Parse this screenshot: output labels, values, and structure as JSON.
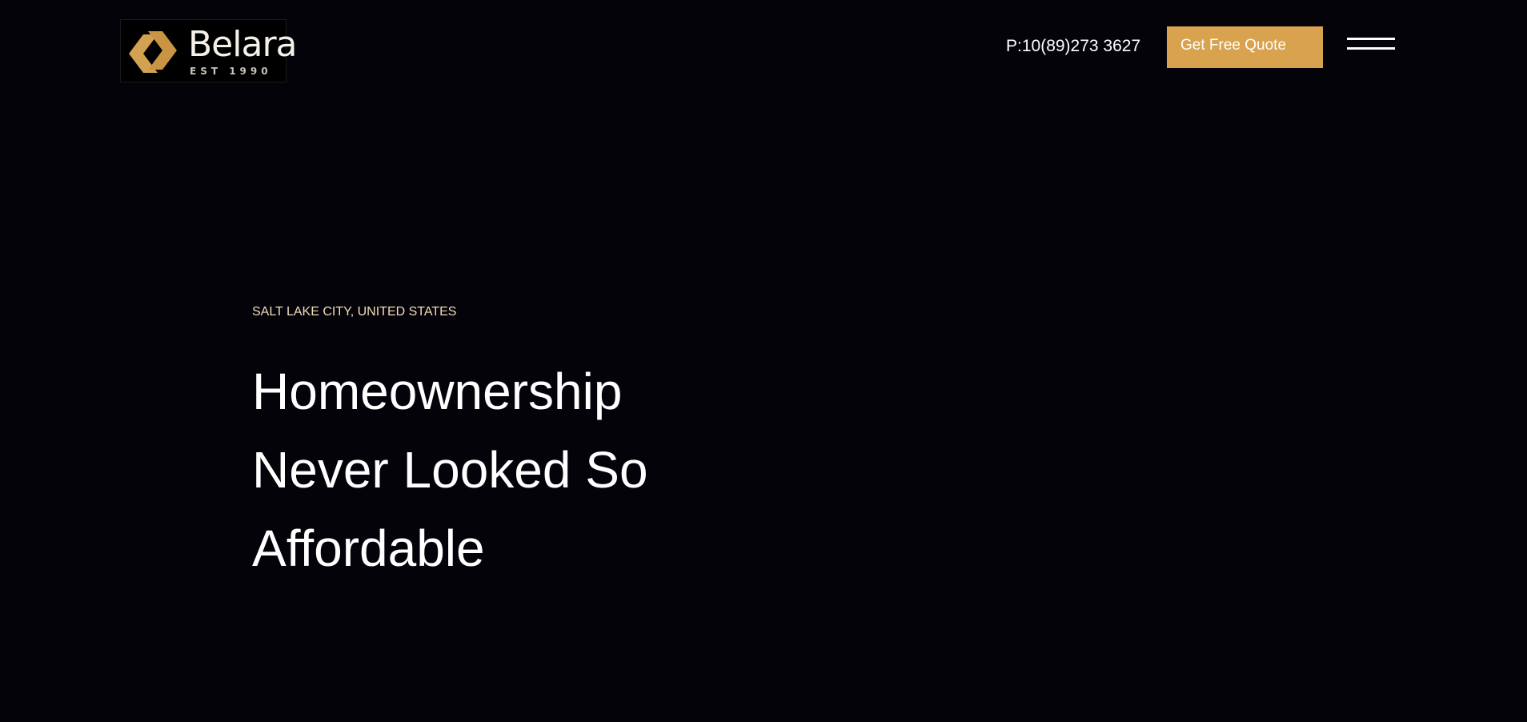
{
  "header": {
    "logo": {
      "name": "Belara",
      "tagline": "EST 1990"
    },
    "phone": "P:10(89)273 3627",
    "cta_label": "Get Free Quote",
    "menu_icon": "hamburger-menu-icon"
  },
  "hero": {
    "location": "SALT LAKE CITY, UNITED STATES",
    "heading_lines": [
      "Homeownership",
      "Never Looked So",
      "Affordable"
    ]
  },
  "colors": {
    "background": "#05030a",
    "accent": "#d8a24e",
    "location_text": "#f1dfb8",
    "text": "#ffffff"
  }
}
